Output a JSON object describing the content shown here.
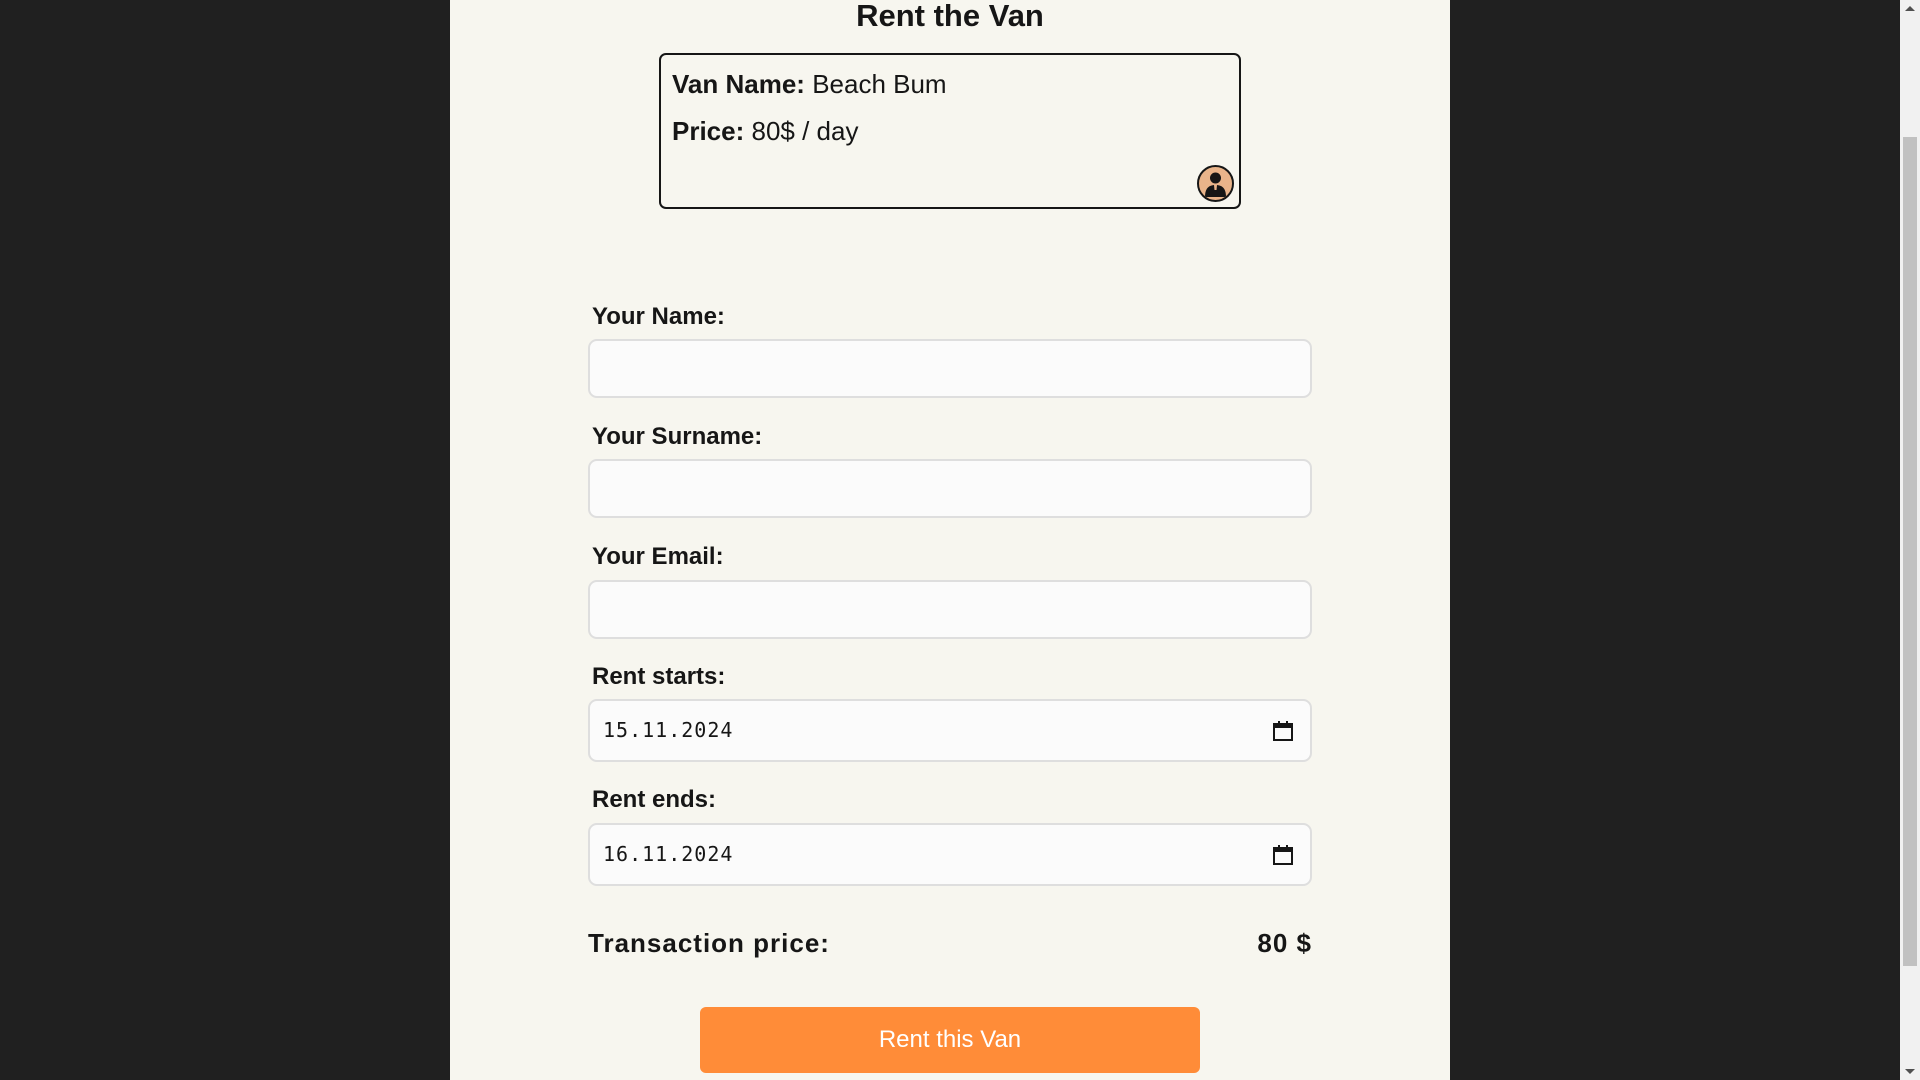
{
  "page": {
    "title": "Rent the Van"
  },
  "van": {
    "name_label": "Van Name:",
    "name_value": "Beach Bum",
    "price_label": "Price:",
    "price_value": "80$ / day",
    "avatar_icon": "user-avatar-icon"
  },
  "form": {
    "name_label": "Your Name:",
    "name_value": "",
    "surname_label": "Your Surname:",
    "surname_value": "",
    "email_label": "Your Email:",
    "email_value": "",
    "start_label": "Rent starts:",
    "start_value": "15.11.2024",
    "end_label": "Rent ends:",
    "end_value": "16.11.2024",
    "calendar_icon": "calendar-icon"
  },
  "summary": {
    "label": "Transaction price:",
    "value": "80 $"
  },
  "actions": {
    "rent_label": "Rent this Van"
  },
  "colors": {
    "page_bg": "#f7f6ef",
    "outer_bg": "#202020",
    "accent": "#ff8c38"
  }
}
